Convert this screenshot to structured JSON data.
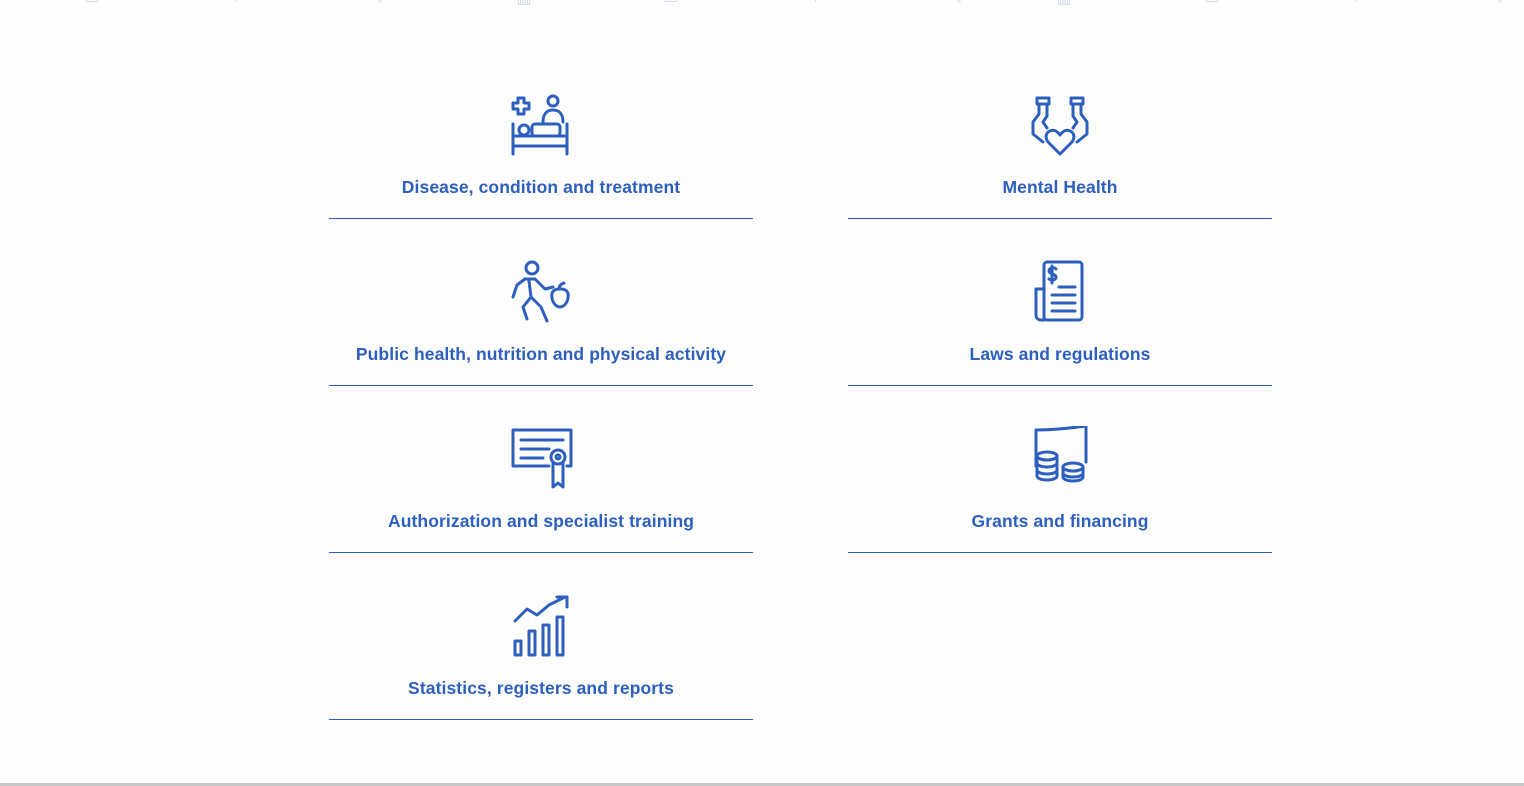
{
  "colors": {
    "accent": "#2d5fbf",
    "divider": "#2a5fbe",
    "background": "#fcfdfc",
    "pattern": "#cfd9ee"
  },
  "categories": [
    {
      "label": "Disease, condition and treatment",
      "icon": "patient-bed-icon"
    },
    {
      "label": "Mental Health",
      "icon": "hands-heart-icon"
    },
    {
      "label": "Public health, nutrition and physical activity",
      "icon": "running-person-apple-icon"
    },
    {
      "label": "Laws and regulations",
      "icon": "document-dollar-icon"
    },
    {
      "label": "Authorization and specialist training",
      "icon": "certificate-icon"
    },
    {
      "label": "Grants and financing",
      "icon": "money-coins-icon"
    },
    {
      "label": "Statistics, registers and reports",
      "icon": "bar-chart-growth-icon"
    }
  ]
}
